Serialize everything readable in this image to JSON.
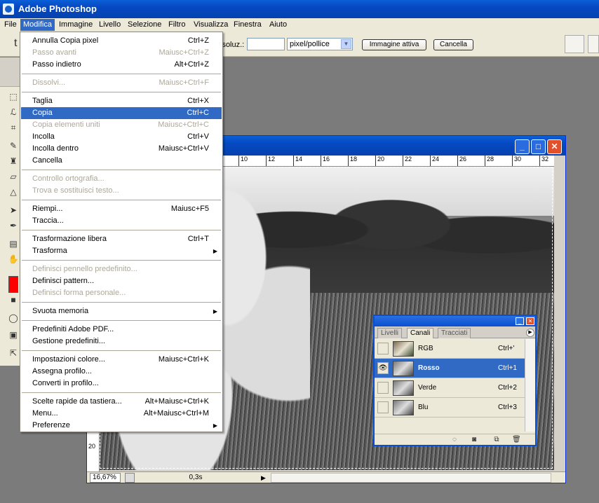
{
  "app": {
    "title": "Adobe Photoshop"
  },
  "menubar": {
    "items": [
      "File",
      "Modifica",
      "Immagine",
      "Livello",
      "Selezione",
      "Filtro",
      "Visualizza",
      "Finestra",
      "Aiuto"
    ],
    "active": "Modifica"
  },
  "options": {
    "resolution_label": "isoluz.:",
    "resolution_value": "",
    "unit_select": "pixel/pollice",
    "front_image_button": "Immagine attiva",
    "clear_button": "Cancella"
  },
  "edit_menu": {
    "items": [
      {
        "label": "Annulla Copia pixel",
        "shortcut": "Ctrl+Z",
        "enabled": true
      },
      {
        "label": "Passo avanti",
        "shortcut": "Maiusc+Ctrl+Z",
        "enabled": false
      },
      {
        "label": "Passo indietro",
        "shortcut": "Alt+Ctrl+Z",
        "enabled": true
      },
      {
        "label": "Dissolvi...",
        "shortcut": "Maiusc+Ctrl+F",
        "enabled": false
      },
      {
        "label": "Taglia",
        "shortcut": "Ctrl+X",
        "enabled": true
      },
      {
        "label": "Copia",
        "shortcut": "Ctrl+C",
        "enabled": true,
        "highlighted": true
      },
      {
        "label": "Copia elementi uniti",
        "shortcut": "Maiusc+Ctrl+C",
        "enabled": false
      },
      {
        "label": "Incolla",
        "shortcut": "Ctrl+V",
        "enabled": true
      },
      {
        "label": "Incolla dentro",
        "shortcut": "Maiusc+Ctrl+V",
        "enabled": true
      },
      {
        "label": "Cancella",
        "shortcut": "",
        "enabled": true
      },
      {
        "label": "Controllo ortografia...",
        "shortcut": "",
        "enabled": false
      },
      {
        "label": "Trova e sostituisci testo...",
        "shortcut": "",
        "enabled": false
      },
      {
        "label": "Riempi...",
        "shortcut": "Maiusc+F5",
        "enabled": true
      },
      {
        "label": "Traccia...",
        "shortcut": "",
        "enabled": true
      },
      {
        "label": "Trasformazione libera",
        "shortcut": "Ctrl+T",
        "enabled": true
      },
      {
        "label": "Trasforma",
        "shortcut": "",
        "enabled": true,
        "submenu": true
      },
      {
        "label": "Definisci pennello predefinito...",
        "shortcut": "",
        "enabled": false
      },
      {
        "label": "Definisci pattern...",
        "shortcut": "",
        "enabled": true
      },
      {
        "label": "Definisci forma personale...",
        "shortcut": "",
        "enabled": false
      },
      {
        "label": "Svuota memoria",
        "shortcut": "",
        "enabled": true,
        "submenu": true
      },
      {
        "label": "Predefiniti Adobe PDF...",
        "shortcut": "",
        "enabled": true
      },
      {
        "label": "Gestione predefiniti...",
        "shortcut": "",
        "enabled": true
      },
      {
        "label": "Impostazioni colore...",
        "shortcut": "Maiusc+Ctrl+K",
        "enabled": true
      },
      {
        "label": "Assegna profilo...",
        "shortcut": "",
        "enabled": true
      },
      {
        "label": "Converti in profilo...",
        "shortcut": "",
        "enabled": true
      },
      {
        "label": "Scelte rapide da tastiera...",
        "shortcut": "Alt+Maiusc+Ctrl+K",
        "enabled": true
      },
      {
        "label": "Menu...",
        "shortcut": "Alt+Maiusc+Ctrl+M",
        "enabled": true
      },
      {
        "label": "Preferenze",
        "shortcut": "",
        "enabled": true,
        "submenu": true
      }
    ],
    "separators_after": [
      2,
      3,
      9,
      11,
      13,
      15,
      18,
      19,
      21,
      24
    ]
  },
  "document": {
    "ruler_ticks": [
      "10",
      "12",
      "14",
      "16",
      "18",
      "20",
      "22",
      "24",
      "26",
      "28",
      "30",
      "32"
    ],
    "left_ruler_label": "20",
    "zoom": "16,67%",
    "timing": "0,3s"
  },
  "channels_panel": {
    "tabs": [
      "Livelli",
      "Canali",
      "Tracciati"
    ],
    "active_tab": "Canali",
    "channels": [
      {
        "name": "RGB",
        "shortcut": "Ctrl+'",
        "visible": false,
        "selected": false
      },
      {
        "name": "Rosso",
        "shortcut": "Ctrl+1",
        "visible": true,
        "selected": true
      },
      {
        "name": "Verde",
        "shortcut": "Ctrl+2",
        "visible": false,
        "selected": false
      },
      {
        "name": "Blu",
        "shortcut": "Ctrl+3",
        "visible": false,
        "selected": false
      }
    ]
  },
  "colors": {
    "foreground": "#ff0000",
    "selection": "#316ac5",
    "titlebar": "#0a5fd8"
  }
}
